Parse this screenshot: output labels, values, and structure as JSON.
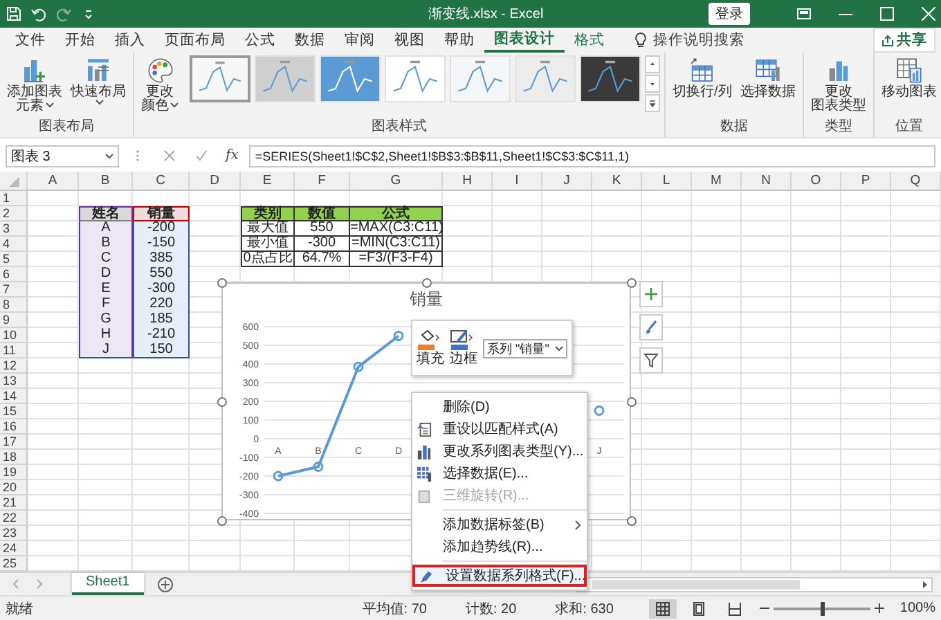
{
  "title_bar": {
    "title": "渐变线.xlsx  -  Excel",
    "login": "登录"
  },
  "tabs": [
    {
      "label": "文件",
      "selected": false,
      "kind": "normal"
    },
    {
      "label": "开始",
      "selected": false,
      "kind": "normal"
    },
    {
      "label": "插入",
      "selected": false,
      "kind": "normal"
    },
    {
      "label": "页面布局",
      "selected": false,
      "kind": "normal"
    },
    {
      "label": "公式",
      "selected": false,
      "kind": "normal"
    },
    {
      "label": "数据",
      "selected": false,
      "kind": "normal"
    },
    {
      "label": "审阅",
      "selected": false,
      "kind": "normal"
    },
    {
      "label": "视图",
      "selected": false,
      "kind": "normal"
    },
    {
      "label": "帮助",
      "selected": false,
      "kind": "normal"
    },
    {
      "label": "图表设计",
      "selected": true,
      "kind": "contextual"
    },
    {
      "label": "格式",
      "selected": false,
      "kind": "contextual"
    }
  ],
  "tell_me": "操作说明搜索",
  "share": "共享",
  "ribbon_groups": [
    {
      "label": "图表布局",
      "buttons": [
        {
          "lines": [
            "添加图表",
            "元素"
          ],
          "has_menu": true
        },
        {
          "lines": [
            "快速布局"
          ],
          "has_menu": true
        }
      ]
    },
    {
      "label": "图表样式",
      "buttons": [
        {
          "lines": [
            "更改",
            "颜色"
          ],
          "has_menu": true
        }
      ],
      "gallery": [
        {
          "kind": "light",
          "selected": true
        },
        {
          "kind": "grey",
          "selected": false
        },
        {
          "kind": "blue",
          "selected": false
        },
        {
          "kind": "white",
          "selected": false
        },
        {
          "kind": "lined",
          "selected": false
        },
        {
          "kind": "hatched",
          "selected": false
        },
        {
          "kind": "dark",
          "selected": false
        }
      ]
    },
    {
      "label": "数据",
      "buttons": [
        {
          "lines": [
            "切换行/列"
          ],
          "has_menu": false
        },
        {
          "lines": [
            "选择数据"
          ],
          "has_menu": false
        }
      ]
    },
    {
      "label": "类型",
      "buttons": [
        {
          "lines": [
            "更改",
            "图表类型"
          ],
          "has_menu": false
        }
      ]
    },
    {
      "label": "位置",
      "buttons": [
        {
          "lines": [
            "移动图表"
          ],
          "has_menu": false
        }
      ]
    }
  ],
  "formula_bar": {
    "name_box": "图表 3",
    "function_button": "fx",
    "formula": "=SERIES(Sheet1!$C$2,Sheet1!$B$3:$B$11,Sheet1!$C$3:$C$11,1)"
  },
  "column_headers": [
    "A",
    "B",
    "C",
    "D",
    "E",
    "F",
    "G",
    "H",
    "I",
    "J",
    "K",
    "L",
    "M",
    "N",
    "O",
    "P",
    "Q"
  ],
  "row_numbers": [
    "1",
    "2",
    "3",
    "4",
    "5",
    "6",
    "7",
    "8",
    "9",
    "10",
    "11",
    "12",
    "13",
    "14",
    "15",
    "16",
    "17",
    "18",
    "19",
    "20",
    "21",
    "22",
    "23",
    "24",
    "25"
  ],
  "sales_table": {
    "headers": [
      "姓名",
      "销量"
    ],
    "rows": [
      [
        "A",
        "-200"
      ],
      [
        "B",
        "-150"
      ],
      [
        "C",
        "385"
      ],
      [
        "D",
        "550"
      ],
      [
        "E",
        "-300"
      ],
      [
        "F",
        "220"
      ],
      [
        "G",
        "185"
      ],
      [
        "H",
        "-210"
      ],
      [
        "J",
        "150"
      ]
    ]
  },
  "stats_table": {
    "headers": [
      "类别",
      "数值",
      "公式"
    ],
    "rows": [
      [
        "最大值",
        "550",
        "=MAX(C3:C11)"
      ],
      [
        "最小值",
        "-300",
        "=MIN(C3:C11)"
      ],
      [
        "0点占比",
        "64.7%",
        "=F3/(F3-F4)"
      ]
    ]
  },
  "chart": {
    "chart_data": {
      "type": "line",
      "title": "销量",
      "categories": [
        "A",
        "B",
        "C",
        "D",
        null,
        null,
        null,
        null,
        "J"
      ],
      "grid": true,
      "series": [
        {
          "color": "#5b9bd5",
          "marker": "circle",
          "values": [
            -200,
            -150,
            385,
            550,
            null,
            null,
            null,
            null,
            150
          ]
        }
      ],
      "ylim": [
        -400,
        600
      ],
      "yticks": [
        -400,
        -300,
        -200,
        -100,
        0,
        100,
        200,
        300,
        400,
        500,
        600
      ]
    }
  },
  "mini_toolbar": {
    "buttons": [
      "填充",
      "边框"
    ],
    "series_select": "系列 \"销量\""
  },
  "context_menu": [
    {
      "label": "删除(D)",
      "disabled": false,
      "has_submenu": false,
      "separator_before": false,
      "highlighted": false
    },
    {
      "label": "重设以匹配样式(A)",
      "disabled": false,
      "has_submenu": false,
      "separator_before": false,
      "highlighted": false
    },
    {
      "label": "更改系列图表类型(Y)...",
      "disabled": false,
      "has_submenu": false,
      "separator_before": false,
      "highlighted": false
    },
    {
      "label": "选择数据(E)...",
      "disabled": false,
      "has_submenu": false,
      "separator_before": false,
      "highlighted": false
    },
    {
      "label": "三维旋转(R)...",
      "disabled": true,
      "has_submenu": false,
      "separator_before": false,
      "highlighted": false
    },
    {
      "label": "添加数据标签(B)",
      "disabled": false,
      "has_submenu": true,
      "separator_before": true,
      "highlighted": false
    },
    {
      "label": "添加趋势线(R)...",
      "disabled": false,
      "has_submenu": false,
      "separator_before": false,
      "highlighted": false
    },
    {
      "label": "设置数据系列格式(F)...",
      "disabled": false,
      "has_submenu": false,
      "separator_before": true,
      "highlighted": true
    }
  ],
  "sheets": [
    {
      "label": "Sheet1",
      "selected": true
    }
  ],
  "status_bar": {
    "ready": "就绪",
    "stats": [
      "平均值: 70",
      "计数: 20",
      "求和: 630"
    ],
    "views": [
      {
        "selected": true
      },
      {
        "selected": false
      },
      {
        "selected": false
      }
    ],
    "zoom": {
      "level": 0.5,
      "reading": "100%"
    }
  }
}
